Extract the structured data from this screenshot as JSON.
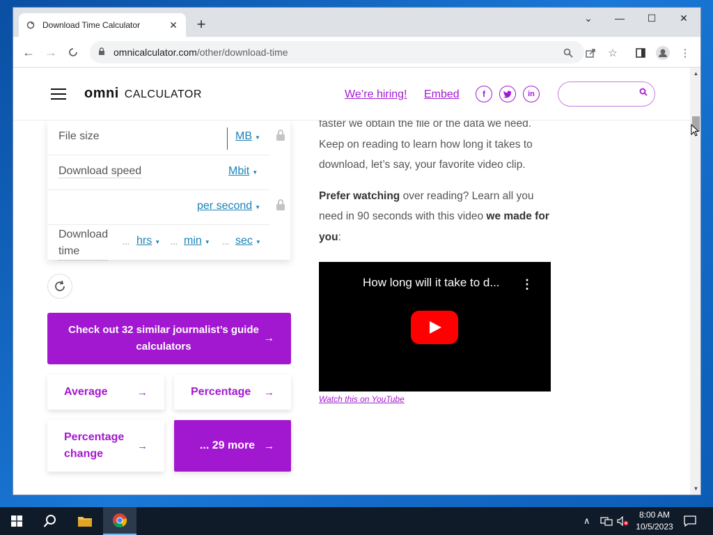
{
  "browser": {
    "tab_title": "Download Time Calculator",
    "new_tab_label": "+",
    "url_domain": "omnicalculator.com",
    "url_path": "/other/download-time"
  },
  "site": {
    "logo_omni": "omni",
    "logo_calc": "CALCULATOR",
    "hiring_link": "We’re hiring!",
    "embed_link": "Embed",
    "social": [
      "f",
      "t",
      "in"
    ]
  },
  "calculator": {
    "file_size_label": "File size",
    "file_size_unit": "MB",
    "download_speed_label": "Download speed",
    "download_speed_unit": "Mbit",
    "per_unit": "per second",
    "download_time_label_1": "Download",
    "download_time_label_2": "time",
    "ellipsis": "...",
    "unit_hrs": "hrs",
    "unit_min": "min",
    "unit_sec": "sec",
    "caret": "▼"
  },
  "related": {
    "cta": "Check out 32 similar journalist’s guide calculators",
    "items": [
      {
        "label": "Average"
      },
      {
        "label": "Percentage"
      },
      {
        "label": "Percentage change"
      }
    ],
    "more": "... 29 more",
    "arrow": "→"
  },
  "article": {
    "line_partial": "faster we obtain the file or the data we need.",
    "para1": "Keep on reading to learn how long it takes to download, let’s say, your favorite video clip.",
    "prefer_bold": "Prefer watching",
    "prefer_rest_1": " over reading? Learn all you need in 90 seconds with this video ",
    "prefer_bold_2": "we made for you",
    "prefer_end": ":"
  },
  "video": {
    "title": "How long will it take to d...",
    "watch_link": "Watch this on YouTube"
  },
  "taskbar": {
    "time": "8:00 AM",
    "date": "10/5/2023"
  },
  "colors": {
    "brand": "#a218d0",
    "unit_link": "#1a82b8"
  }
}
